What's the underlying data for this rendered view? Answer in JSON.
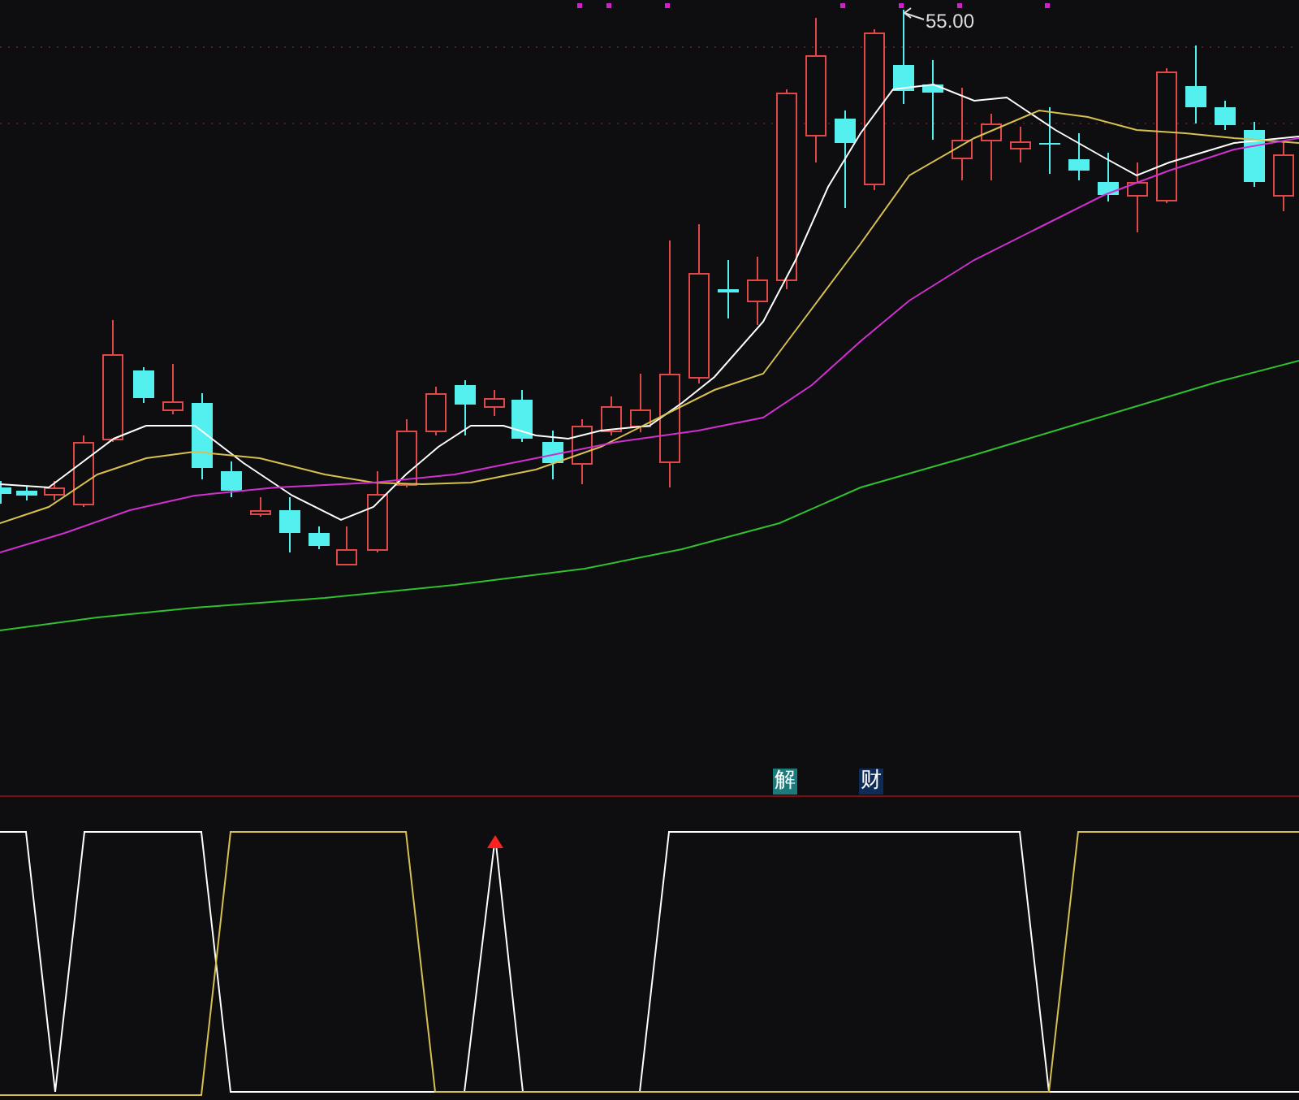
{
  "price_chart": {
    "high_label": "55.00"
  },
  "indicator_panel": {
    "badges": [
      {
        "text": "解",
        "color": "#1b7b7b"
      },
      {
        "text": "财",
        "color": "#0e2c58"
      }
    ]
  }
}
